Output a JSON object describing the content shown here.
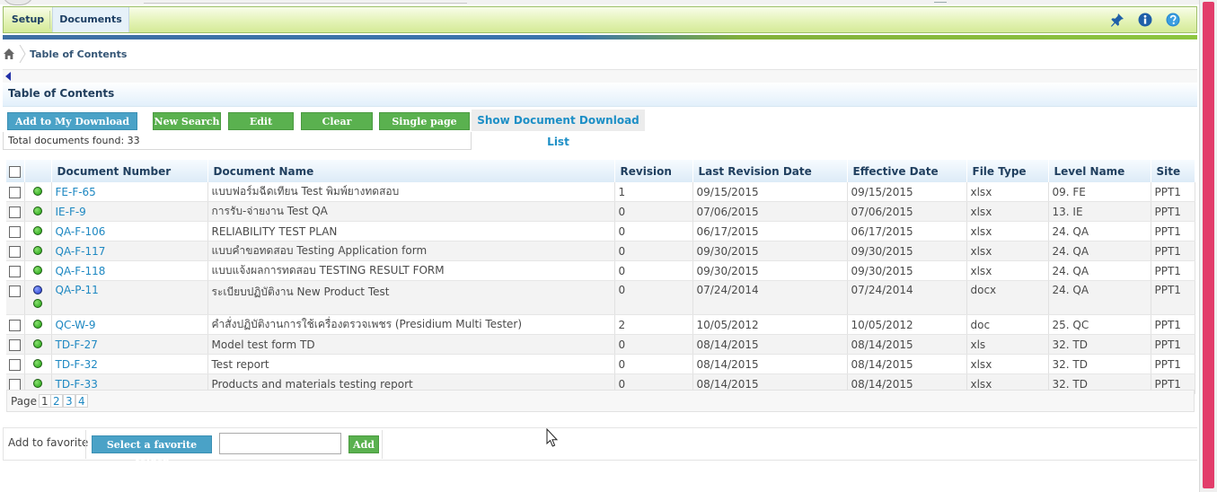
{
  "menu": {
    "setup": "Setup",
    "documents": "Documents"
  },
  "toolbar_icons": [
    "pin-icon",
    "info-icon",
    "help-icon"
  ],
  "breadcrumb": {
    "current": "Table of Contents"
  },
  "section": {
    "title": "Table of Contents"
  },
  "actions": {
    "add_to_download": "Add to My Download List",
    "new_search": "New Search",
    "edit_search": "Edit Search",
    "clear_search": "Clear Search",
    "single_page_toc": "Single page TOC",
    "show_download_list": "Show Document Download List"
  },
  "summary": {
    "total_found": "Total documents found: 33"
  },
  "table": {
    "headers": [
      "Document Number",
      "Document Name",
      "Revision",
      "Last Revision Date",
      "Effective Date",
      "File Type",
      "Level Name",
      "Site"
    ],
    "rows": [
      {
        "status": [
          "green"
        ],
        "number": "FE-F-65",
        "name": "แบบฟอร์มฉีดเทียน Test พิมพ์ยางทดสอบ",
        "revision": "1",
        "last_revision_date": "09/15/2015",
        "effective_date": "09/15/2015",
        "file_type": "xlsx",
        "level": "09. FE",
        "site": "PPT1"
      },
      {
        "status": [
          "green"
        ],
        "number": "IE-F-9",
        "name": "การรับ-จ่ายงาน Test QA",
        "revision": "0",
        "last_revision_date": "07/06/2015",
        "effective_date": "07/06/2015",
        "file_type": "xlsx",
        "level": "13. IE",
        "site": "PPT1"
      },
      {
        "status": [
          "green"
        ],
        "number": "QA-F-106",
        "name": "RELIABILITY TEST PLAN",
        "revision": "0",
        "last_revision_date": "06/17/2015",
        "effective_date": "06/17/2015",
        "file_type": "xlsx",
        "level": "24. QA",
        "site": "PPT1"
      },
      {
        "status": [
          "green"
        ],
        "number": "QA-F-117",
        "name": "แบบคำขอทดสอบ Testing Application form",
        "revision": "0",
        "last_revision_date": "09/30/2015",
        "effective_date": "09/30/2015",
        "file_type": "xlsx",
        "level": "24. QA",
        "site": "PPT1"
      },
      {
        "status": [
          "green"
        ],
        "number": "QA-F-118",
        "name": "แบบแจ้งผลการทดสอบ TESTING RESULT FORM",
        "revision": "0",
        "last_revision_date": "09/30/2015",
        "effective_date": "09/30/2015",
        "file_type": "xlsx",
        "level": "24. QA",
        "site": "PPT1"
      },
      {
        "status": [
          "blue",
          "green"
        ],
        "number": "QA-P-11",
        "name": "ระเบียบปฏิบัติงาน New Product Test",
        "revision": "0",
        "last_revision_date": "07/24/2014",
        "effective_date": "07/24/2014",
        "file_type": "docx",
        "level": "24. QA",
        "site": "PPT1"
      },
      {
        "status": [
          "green"
        ],
        "number": "QC-W-9",
        "name": "คำสั่งปฏิบัติงานการใช้เครื่องตรวจเพชร (Presidium Multi Tester)",
        "revision": "2",
        "last_revision_date": "10/05/2012",
        "effective_date": "10/05/2012",
        "file_type": "doc",
        "level": "25. QC",
        "site": "PPT1"
      },
      {
        "status": [
          "green"
        ],
        "number": "TD-F-27",
        "name": "Model test form TD",
        "revision": "0",
        "last_revision_date": "08/14/2015",
        "effective_date": "08/14/2015",
        "file_type": "xls",
        "level": "32. TD",
        "site": "PPT1"
      },
      {
        "status": [
          "green"
        ],
        "number": "TD-F-32",
        "name": "Test report",
        "revision": "0",
        "last_revision_date": "08/14/2015",
        "effective_date": "08/14/2015",
        "file_type": "xlsx",
        "level": "32. TD",
        "site": "PPT1"
      },
      {
        "status": [
          "green"
        ],
        "number": "TD-F-33",
        "name": "Products and materials testing report",
        "revision": "0",
        "last_revision_date": "08/14/2015",
        "effective_date": "08/14/2015",
        "file_type": "xlsx",
        "level": "32. TD",
        "site": "PPT1"
      }
    ]
  },
  "pager": {
    "label": "Page",
    "pages": [
      "1",
      "2",
      "3",
      "4"
    ],
    "current": "1"
  },
  "favorite": {
    "label": "Add to favorite",
    "select_folder": "Select a favorite folder",
    "input_value": "",
    "add": "Add"
  },
  "colors": {
    "menubar": "#e4f3b7",
    "link": "#1e88c2",
    "blue_button": "#4aa2c7",
    "green_button": "#5ab14f",
    "scrollbar_thumb": "#e23d6a"
  }
}
